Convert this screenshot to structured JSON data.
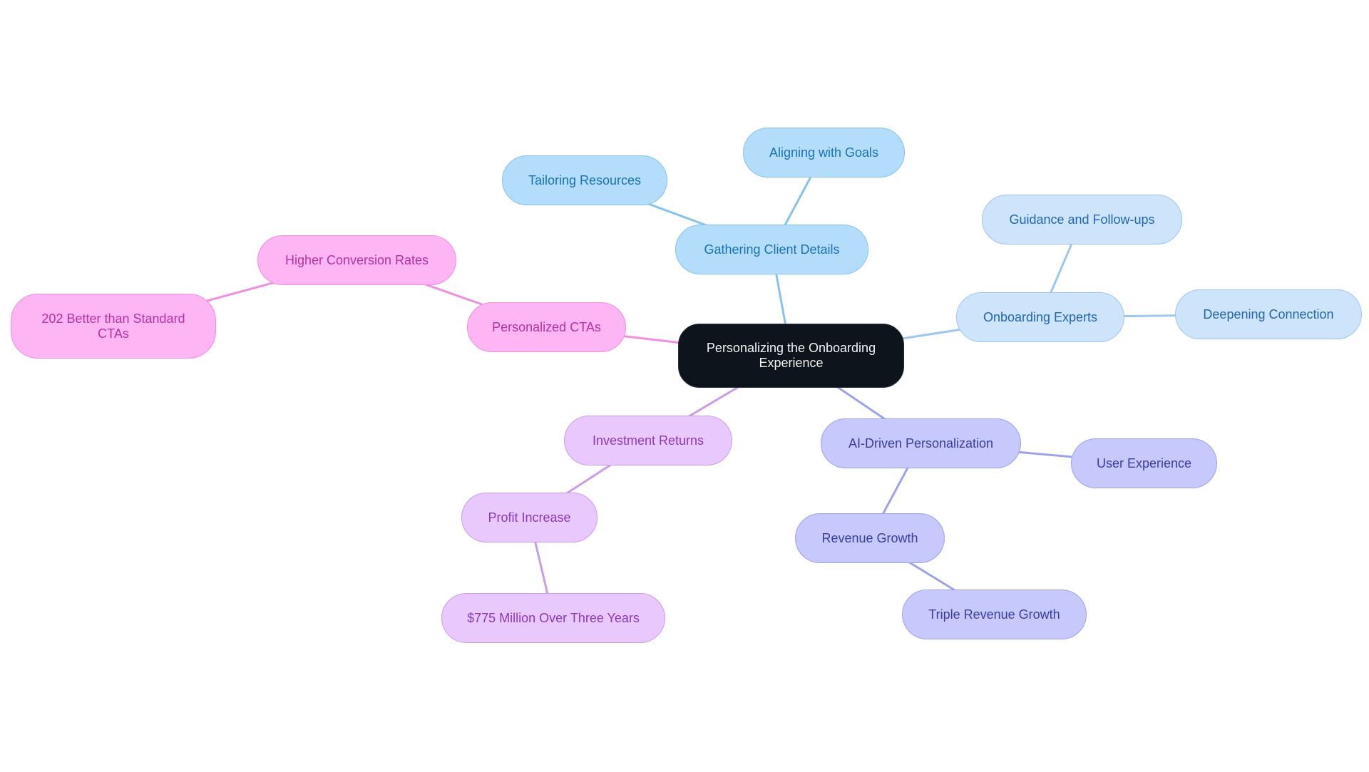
{
  "diagram": {
    "type": "mindmap",
    "root": {
      "id": "root",
      "label": "Personalizing the Onboarding Experience"
    },
    "colors": {
      "root_bg": "#0d141b",
      "blue": "#86c3ec",
      "light_blue": "#9fc6ef",
      "pink": "#ee8fe0",
      "violet": "#cc9ce9",
      "indigo": "#9da2ec"
    },
    "nodes": [
      {
        "id": "gathering",
        "label": "Gathering Client Details",
        "parent": "root",
        "group": "blue"
      },
      {
        "id": "tailoring",
        "label": "Tailoring Resources",
        "parent": "gathering",
        "group": "blue"
      },
      {
        "id": "aligning",
        "label": "Aligning with Goals",
        "parent": "gathering",
        "group": "blue"
      },
      {
        "id": "experts",
        "label": "Onboarding Experts",
        "parent": "root",
        "group": "light_blue"
      },
      {
        "id": "guidance",
        "label": "Guidance and Follow-ups",
        "parent": "experts",
        "group": "light_blue"
      },
      {
        "id": "deepening",
        "label": "Deepening Connection",
        "parent": "experts",
        "group": "light_blue"
      },
      {
        "id": "ctas",
        "label": "Personalized CTAs",
        "parent": "root",
        "group": "pink"
      },
      {
        "id": "conversion",
        "label": "Higher Conversion Rates",
        "parent": "ctas",
        "group": "pink"
      },
      {
        "id": "better",
        "label": "202 Better than Standard CTAs",
        "parent": "conversion",
        "group": "pink"
      },
      {
        "id": "investment",
        "label": "Investment Returns",
        "parent": "root",
        "group": "violet"
      },
      {
        "id": "profit",
        "label": "Profit Increase",
        "parent": "investment",
        "group": "violet"
      },
      {
        "id": "million",
        "label": "$775 Million Over Three Years",
        "parent": "profit",
        "group": "violet"
      },
      {
        "id": "ai",
        "label": "AI-Driven Personalization",
        "parent": "root",
        "group": "indigo"
      },
      {
        "id": "ux",
        "label": "User Experience",
        "parent": "ai",
        "group": "indigo"
      },
      {
        "id": "revenue",
        "label": "Revenue Growth",
        "parent": "ai",
        "group": "indigo"
      },
      {
        "id": "triple",
        "label": "Triple Revenue Growth",
        "parent": "revenue",
        "group": "indigo"
      }
    ]
  }
}
